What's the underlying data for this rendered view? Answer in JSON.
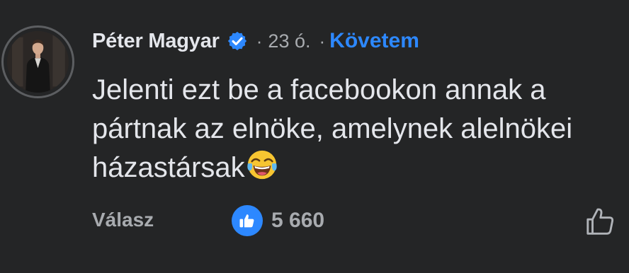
{
  "comment": {
    "author": "Péter Magyar",
    "verified_icon": "verified-badge-icon",
    "separator": "·",
    "time": "23 ó.",
    "separator2": "·",
    "follow_label": "Követem",
    "text_lines": [
      "Jelenti ezt be a facebookon annak a",
      "pártnak az elnöke, amelynek alelnökei",
      "házastársak"
    ],
    "emoji": "face-with-tears-of-joy-icon",
    "reply_label": "Válasz",
    "reaction_icon": "like-reaction-icon",
    "reaction_count": "5 660",
    "like_button_icon": "thumbs-up-outline-icon"
  },
  "colors": {
    "background": "#242526",
    "text": "#e4e6eb",
    "secondary_text": "#a8abaf",
    "accent": "#2d88ff"
  }
}
